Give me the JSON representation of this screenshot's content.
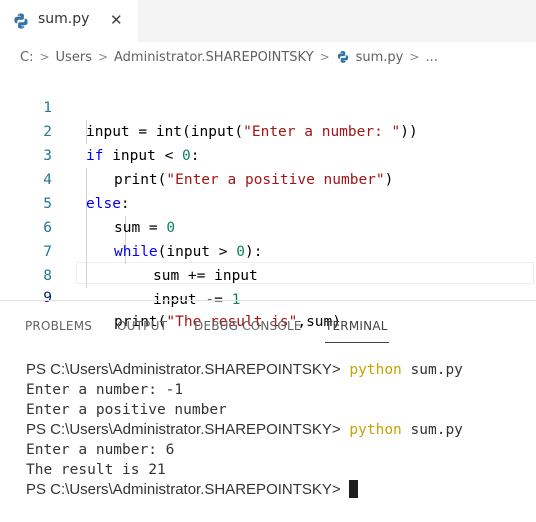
{
  "tab": {
    "title": "sum.py",
    "close": "✕"
  },
  "breadcrumb": [
    "C:",
    "Users",
    "Administrator.SHAREPOINTSKY",
    "sum.py"
  ],
  "editor": {
    "lines": [
      {
        "n": "1"
      },
      {
        "n": "2"
      },
      {
        "n": "3"
      },
      {
        "n": "4"
      },
      {
        "n": "5"
      },
      {
        "n": "6"
      },
      {
        "n": "7"
      },
      {
        "n": "8"
      },
      {
        "n": "9"
      }
    ],
    "code": {
      "l1a": "input = int(input(",
      "l1s": "\"Enter a number: \"",
      "l1b": "))",
      "l2kw": "if",
      "l2a": " input < ",
      "l2n": "0",
      "l2b": ":",
      "l3a": "print(",
      "l3s": "\"Enter a positive number\"",
      "l3b": ")",
      "l4kw": "else",
      "l4b": ":",
      "l5a": "sum = ",
      "l5n": "0",
      "l6kw": "while",
      "l6a": "(input > ",
      "l6n": "0",
      "l6b": "):",
      "l7": "sum += input",
      "l8a": "input -= ",
      "l8n": "1",
      "l9a": "print(",
      "l9s": "\"The result is\"",
      "l9b": ",sum)"
    }
  },
  "panel": {
    "tabs": [
      "PROBLEMS",
      "OUTPUT",
      "DEBUG CONSOLE",
      "TERMINAL"
    ],
    "active": "TERMINAL"
  },
  "terminal": {
    "prompt": "PS C:\\Users\\Administrator.SHAREPOINTSKY>",
    "cmd_word": "python",
    "cmd_arg": " sum.py",
    "out1": "Enter a number: -1",
    "out2": "Enter a positive number",
    "out3": "Enter a number: 6",
    "out4": "The result is 21"
  },
  "colors": {
    "keyword": "#0000ff",
    "string": "#a31515",
    "number": "#098658",
    "line_number": "#237893",
    "terminal_command": "#c7a200"
  }
}
